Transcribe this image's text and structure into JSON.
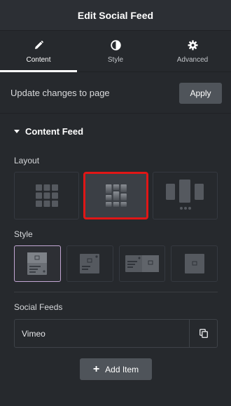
{
  "header": {
    "title": "Edit Social Feed"
  },
  "tabs": [
    {
      "label": "Content",
      "icon": "pencil-icon",
      "active": true
    },
    {
      "label": "Style",
      "icon": "contrast-icon",
      "active": false
    },
    {
      "label": "Advanced",
      "icon": "gear-icon",
      "active": false
    }
  ],
  "update": {
    "text": "Update changes to page",
    "apply_label": "Apply"
  },
  "section": {
    "title": "Content Feed"
  },
  "layout": {
    "label": "Layout",
    "options": [
      "grid",
      "masonry",
      "carousel"
    ],
    "selected": "masonry"
  },
  "style": {
    "label": "Style",
    "options": [
      "card-stacked",
      "card-overlay",
      "card-horizontal",
      "card-image-only"
    ],
    "selected": "card-stacked"
  },
  "social_feeds": {
    "label": "Social Feeds",
    "items": [
      {
        "label": "Vimeo"
      }
    ]
  },
  "add_item": {
    "label": "Add Item"
  },
  "colors": {
    "selection_red": "#e01616",
    "selection_purple": "#c3a7d4",
    "panel_bg": "#26292d",
    "button_bg": "#4f545a"
  }
}
